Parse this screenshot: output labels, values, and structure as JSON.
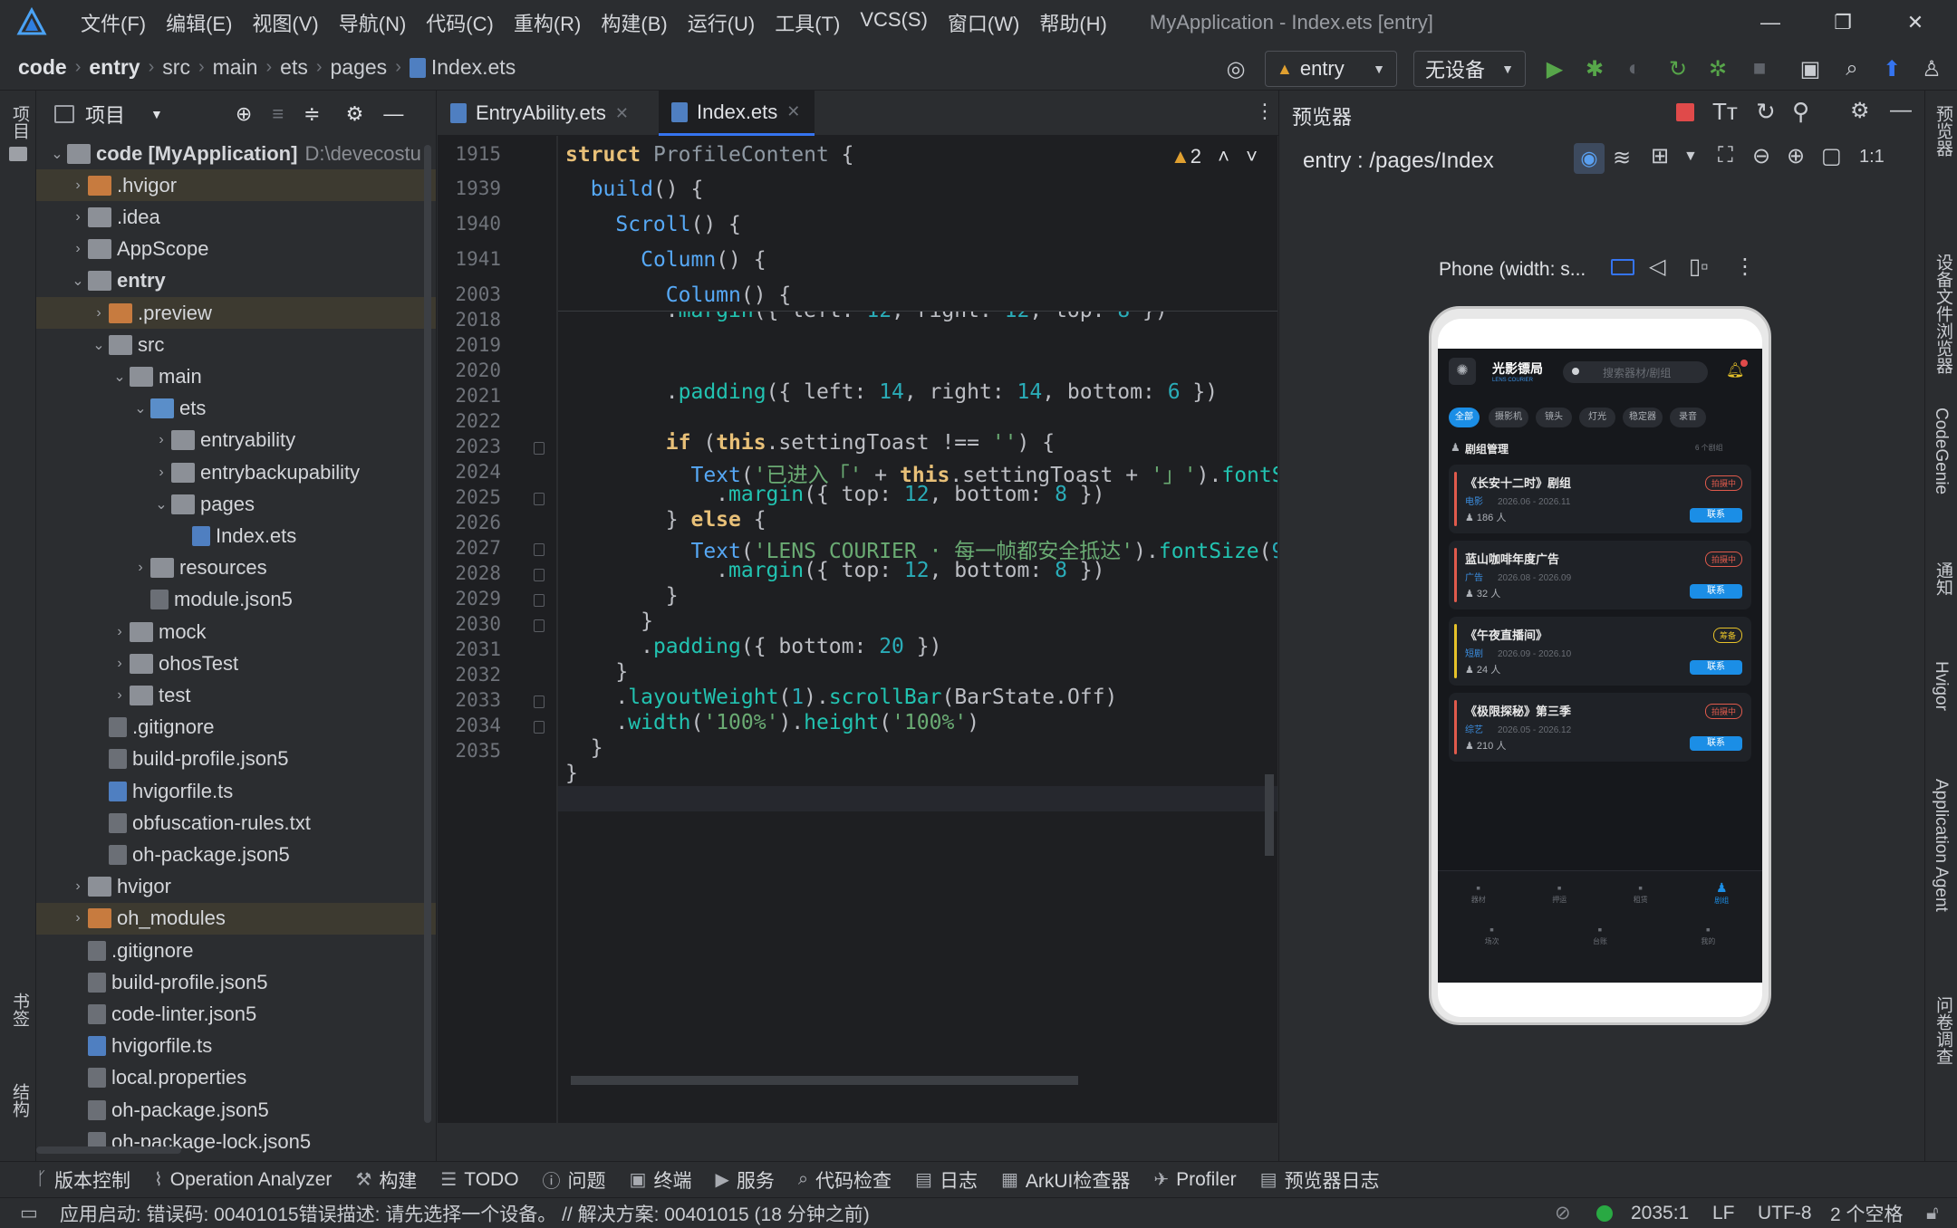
{
  "titlebar": {
    "menus": [
      "文件(F)",
      "编辑(E)",
      "视图(V)",
      "导航(N)",
      "代码(C)",
      "重构(R)",
      "构建(B)",
      "运行(U)",
      "工具(T)",
      "VCS(S)",
      "窗口(W)",
      "帮助(H)"
    ],
    "window_title": "MyApplication - Index.ets [entry]",
    "minimize": "—",
    "restore": "❐",
    "close": "✕"
  },
  "navbar": {
    "crumbs": [
      "code",
      "entry",
      "src",
      "main",
      "ets",
      "pages",
      "Index.ets"
    ],
    "run_config": "entry",
    "device": "无设备"
  },
  "left_strip": {
    "project_label": "项目",
    "bookmarks_label": "书签",
    "structure_label": "结构"
  },
  "project_panel": {
    "title": "项目",
    "tree": [
      {
        "label": "code [MyApplication]",
        "suffix": "D:\\devecostu",
        "type": "root"
      },
      {
        "label": ".hvigor",
        "type": "folder-orange"
      },
      {
        "label": ".idea",
        "type": "folder"
      },
      {
        "label": "AppScope",
        "type": "folder"
      },
      {
        "label": "entry",
        "type": "folder"
      },
      {
        "label": ".preview",
        "type": "folder-orange"
      },
      {
        "label": "src",
        "type": "folder"
      },
      {
        "label": "main",
        "type": "folder"
      },
      {
        "label": "ets",
        "type": "folder-blue"
      },
      {
        "label": "entryability",
        "type": "folder"
      },
      {
        "label": "entrybackupability",
        "type": "folder"
      },
      {
        "label": "pages",
        "type": "folder"
      },
      {
        "label": "Index.ets",
        "type": "file-ets"
      },
      {
        "label": "resources",
        "type": "folder"
      },
      {
        "label": "module.json5",
        "type": "file"
      },
      {
        "label": "mock",
        "type": "folder"
      },
      {
        "label": "ohosTest",
        "type": "folder"
      },
      {
        "label": "test",
        "type": "folder"
      },
      {
        "label": ".gitignore",
        "type": "file"
      },
      {
        "label": "build-profile.json5",
        "type": "file"
      },
      {
        "label": "hvigorfile.ts",
        "type": "file-ets"
      },
      {
        "label": "obfuscation-rules.txt",
        "type": "file"
      },
      {
        "label": "oh-package.json5",
        "type": "file"
      },
      {
        "label": "hvigor",
        "type": "folder"
      },
      {
        "label": "oh_modules",
        "type": "folder-orange"
      },
      {
        "label": ".gitignore",
        "type": "file"
      },
      {
        "label": "build-profile.json5",
        "type": "file"
      },
      {
        "label": "code-linter.json5",
        "type": "file"
      },
      {
        "label": "hvigorfile.ts",
        "type": "file-ets"
      },
      {
        "label": "local.properties",
        "type": "file"
      },
      {
        "label": "oh-package.json5",
        "type": "file"
      },
      {
        "label": "oh-package-lock.json5",
        "type": "file"
      }
    ]
  },
  "editor": {
    "tabs": [
      "EntryAbility.ets",
      "Index.ets"
    ],
    "warnings": "2",
    "sticky_lines": [
      "1915",
      "1939",
      "1940",
      "1941",
      "2003"
    ],
    "line_numbers": [
      "2018",
      "2019",
      "2020",
      "2021",
      "2022",
      "2023",
      "2024",
      "2025",
      "2026",
      "2027",
      "2028",
      "2029",
      "2030",
      "2031",
      "2032",
      "2033",
      "2034",
      "2035"
    ]
  },
  "preview": {
    "title": "预览器",
    "route": "entry : /pages/Index",
    "device_label": "Phone (width: s...",
    "app": {
      "name": "光影镖局",
      "sub": "LENS COURIER",
      "search": "搜索器材/剧组",
      "chips": [
        "全部",
        "摄影机",
        "镜头",
        "灯光",
        "稳定器",
        "录音"
      ],
      "section": "剧组管理",
      "section_count": "6 个剧组",
      "cards": [
        {
          "title": "《长安十二时》剧组",
          "type": "电影",
          "dates": "2026.06 - 2026.11",
          "people": "186 人",
          "status": "拍摄中",
          "action": "联系",
          "color": "#e05a4c"
        },
        {
          "title": "蓝山咖啡年度广告",
          "type": "广告",
          "dates": "2026.08 - 2026.09",
          "people": "32 人",
          "status": "拍摄中",
          "action": "联系",
          "color": "#e05a4c"
        },
        {
          "title": "《午夜直播间》",
          "type": "短剧",
          "dates": "2026.09 - 2026.10",
          "people": "24 人",
          "status": "筹备",
          "action": "联系",
          "color": "#e6c229"
        },
        {
          "title": "《极限探秘》第三季",
          "type": "综艺",
          "dates": "2026.05 - 2026.12",
          "people": "210 人",
          "status": "拍摄中",
          "action": "联系",
          "color": "#e05a4c"
        }
      ],
      "tabs_row1": [
        "器材",
        "押运",
        "租赁",
        "剧组"
      ],
      "tabs_row2": [
        "场次",
        "台账",
        "我的"
      ]
    }
  },
  "right_strip": [
    "预览器",
    "设备文件浏览器",
    "CodeGenie",
    "通知",
    "Hvigor",
    "Application Agent",
    "问卷调查"
  ],
  "bottom_tools": [
    "版本控制",
    "Operation Analyzer",
    "构建",
    "TODO",
    "问题",
    "终端",
    "服务",
    "代码检查",
    "日志",
    "ArkUI检查器",
    "Profiler",
    "预览器日志"
  ],
  "status": {
    "message": "应用启动: 错误码: 00401015错误描述: 请先选择一个设备。 // 解决方案: 00401015 (18 分钟之前)",
    "position": "2035:1",
    "line_sep": "LF",
    "encoding": "UTF-8",
    "indent": "2 个空格"
  }
}
